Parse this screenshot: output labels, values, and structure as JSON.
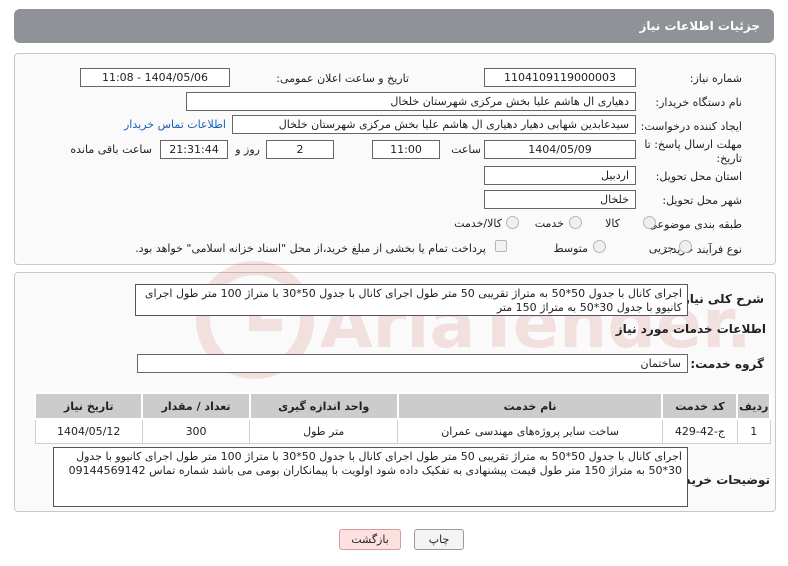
{
  "header": {
    "title": "جزئیات اطلاعات نیاز"
  },
  "watermark": {
    "text": "AriaTender.neT"
  },
  "form": {
    "need_number_label": "شماره نیاز:",
    "need_number": "1104109119000003",
    "announce_label": "تاریخ و ساعت اعلان عمومی:",
    "announce_value": "1404/05/06 - 11:08",
    "buyer_org_label": "نام دستگاه خریدار:",
    "buyer_org": "دهیاری ال هاشم علیا بخش مرکزی شهرستان خلخال",
    "creator_label": "ایجاد کننده درخواست:",
    "creator": "سیدعابدین شهابی دهیار دهیاری ال هاشم علیا بخش مرکزی شهرستان خلخال",
    "contact_link": "اطلاعات تماس خریدار",
    "deadline_label_1": "مهلت ارسال پاسخ: تا",
    "deadline_label_2": "تاریخ:",
    "deadline_date": "1404/05/09",
    "time_label": "ساعت",
    "deadline_time": "11:00",
    "days_value": "2",
    "days_label": "روز و",
    "remaining_time": "21:31:44",
    "remaining_label": "ساعت باقی مانده",
    "province_label": "استان محل تحویل:",
    "province": "اردبیل",
    "city_label": "شهر محل تحویل:",
    "city": "خلخال",
    "category_label": "طبقه بندی موضوعی:",
    "category_options": [
      "کالا",
      "خدمت",
      "کالا/خدمت"
    ],
    "category_selected": "خدمت",
    "process_label": "نوع فرآیند خرید :",
    "process_options": [
      "جزیی",
      "متوسط"
    ],
    "payment_note": "پرداخت تمام یا بخشی از مبلغ خرید،از محل \"اسناد خزانه اسلامی\" خواهد بود."
  },
  "summary": {
    "label": "شرح کلی نیاز:",
    "text": "اجرای کانال با جدول 50*50 به متراژ تقریبی 50 متر طول اجرای کانال با جدول 50*30 با متراژ 100 متر طول اجرای کانیوو با جدول 30*50 به متراژ 150 متر"
  },
  "services": {
    "section_title": "اطلاعات خدمات مورد نیاز",
    "group_label": "گروه خدمت:",
    "group_value": "ساختمان",
    "columns": [
      "ردیف",
      "کد خدمت",
      "نام خدمت",
      "واحد اندازه گیری",
      "تعداد / مقدار",
      "تاریخ نیاز"
    ],
    "rows": [
      [
        "1",
        "ج-42-429",
        "ساخت سایر پروژه‌های مهندسی عمران",
        "متر طول",
        "300",
        "1404/05/12"
      ]
    ]
  },
  "buyer_notes": {
    "label": "توضیحات خریدار:",
    "text": "اجرای کانال با جدول 50*50 به متراژ تقریبی 50 متر طول اجرای کانال با جدول 50*30 با متراژ 100 متر طول اجرای کانیوو با جدول 30*50 به متراژ  150 متر طول قیمت پیشنهادی به تفکیک  داده شود اولویت با پیمانکاران بومی  می باشد شماره تماس 09144569142"
  },
  "buttons": {
    "print": "چاپ",
    "back": "بازگشت"
  }
}
